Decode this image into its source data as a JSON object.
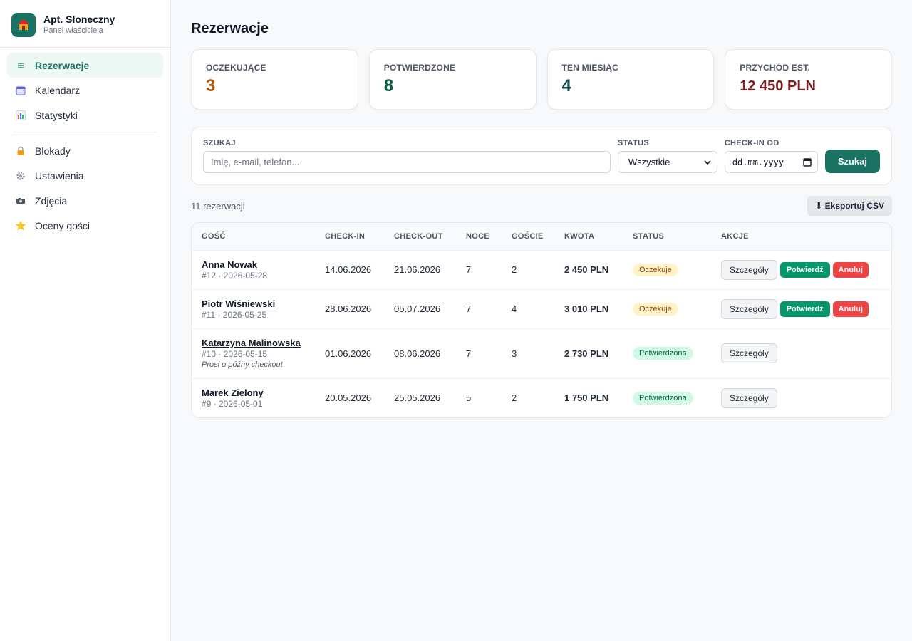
{
  "brand": {
    "name": "Apt. Słoneczny",
    "subtitle": "Panel właściciela",
    "logo_icon": "house-icon",
    "color": "#1a7262"
  },
  "sidebar": {
    "items": [
      {
        "label": "Rezerwacje",
        "icon": "list-icon",
        "active": true
      },
      {
        "label": "Kalendarz",
        "icon": "calendar-icon"
      },
      {
        "label": "Statystyki",
        "icon": "bar-chart-icon"
      },
      {
        "label": "Blokady",
        "icon": "lock-icon"
      },
      {
        "label": "Ustawienia",
        "icon": "gear-icon"
      },
      {
        "label": "Zdjęcia",
        "icon": "camera-icon"
      },
      {
        "label": "Oceny gości",
        "icon": "star-icon"
      }
    ]
  },
  "page": {
    "title": "Rezerwacje"
  },
  "stats": [
    {
      "label": "OCZEKUJĄCE",
      "value": "3",
      "color": "#b45309"
    },
    {
      "label": "POTWIERDZONE",
      "value": "8",
      "color": "#065f46"
    },
    {
      "label": "TEN MIESIĄC",
      "value": "4",
      "color": "#134e4a"
    },
    {
      "label": "PRZYCHÓD EST.",
      "value": "12 450 PLN",
      "color": "#7f1d1d"
    }
  ],
  "filters": {
    "search_label": "SZUKAJ",
    "search_placeholder": "Imię, e-mail, telefon...",
    "status_label": "STATUS",
    "status_value": "Wszystkie",
    "checkin_label": "CHECK-IN OD",
    "checkin_placeholder": "dd.mm.yyyy",
    "search_button": "Szukaj"
  },
  "list": {
    "count_text": "11 rezerwacji",
    "export_label": "⬇ Eksportuj CSV"
  },
  "table": {
    "columns": [
      "GOŚĆ",
      "CHECK-IN",
      "CHECK-OUT",
      "NOCE",
      "GOŚCIE",
      "KWOTA",
      "STATUS",
      "AKCJE"
    ],
    "action_labels": {
      "details": "Szczegóły",
      "confirm": "Potwierdź",
      "cancel": "Anuluj"
    },
    "rows": [
      {
        "name": "Anna Nowak",
        "meta": "#12 · 2026-05-28",
        "note": "",
        "checkin": "14.06.2026",
        "checkout": "21.06.2026",
        "nights": "7",
        "guests": "2",
        "amount": "2 450 PLN",
        "status": "Oczekuje",
        "status_type": "pending"
      },
      {
        "name": "Piotr Wiśniewski",
        "meta": "#11 · 2026-05-25",
        "note": "",
        "checkin": "28.06.2026",
        "checkout": "05.07.2026",
        "nights": "7",
        "guests": "4",
        "amount": "3 010 PLN",
        "status": "Oczekuje",
        "status_type": "pending"
      },
      {
        "name": "Katarzyna Malinowska",
        "meta": "#10 · 2026-05-15",
        "note": "Prosi o późny checkout",
        "checkin": "01.06.2026",
        "checkout": "08.06.2026",
        "nights": "7",
        "guests": "3",
        "amount": "2 730 PLN",
        "status": "Potwierdzona",
        "status_type": "confirmed"
      },
      {
        "name": "Marek Zielony",
        "meta": "#9 · 2026-05-01",
        "note": "",
        "checkin": "20.05.2026",
        "checkout": "25.05.2026",
        "nights": "5",
        "guests": "2",
        "amount": "1 750 PLN",
        "status": "Potwierdzona",
        "status_type": "confirmed"
      }
    ]
  }
}
